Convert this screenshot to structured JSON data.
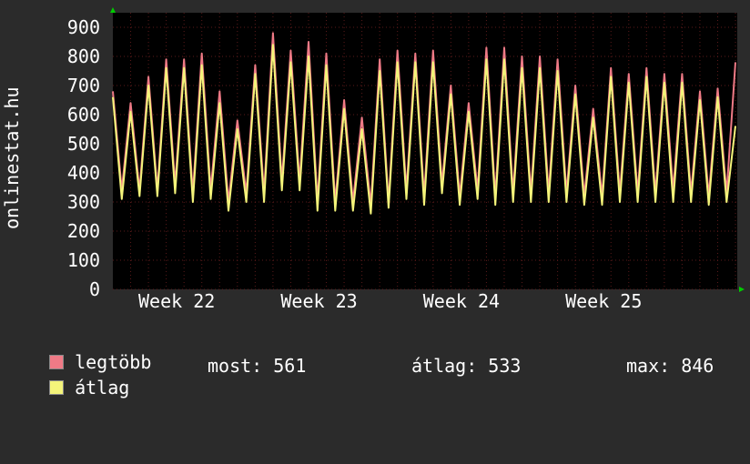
{
  "watermark": "onlinestat.hu",
  "legend": {
    "max_label": "legtöbb",
    "avg_label": "átlag",
    "colors": {
      "max": "#ef7a86",
      "avg": "#f4f47a"
    }
  },
  "stats": {
    "current": "most: 561",
    "average": "átlag: 533",
    "max": "max: 846"
  },
  "chart_data": {
    "type": "line",
    "xlabel": "",
    "ylabel": "",
    "ylim": [
      0,
      950
    ],
    "yticks": [
      0,
      100,
      200,
      300,
      400,
      500,
      600,
      700,
      800,
      900
    ],
    "grid": true,
    "background": "#000000",
    "xtick_labels": [
      "Week 22",
      "Week 23",
      "Week 24",
      "Week 25"
    ],
    "x_unit": "days",
    "xlim": [
      0,
      35.1
    ],
    "xtick_positions": [
      4.0,
      12.0,
      20.0,
      28.0
    ],
    "series": [
      {
        "name": "legtöbb",
        "color": "#ef7a86",
        "x": [
          0,
          0.5,
          1,
          1.5,
          2,
          2.5,
          3,
          3.5,
          4,
          4.5,
          5,
          5.5,
          6,
          6.5,
          7,
          7.5,
          8,
          8.5,
          9,
          9.5,
          10,
          10.5,
          11,
          11.5,
          12,
          12.5,
          13,
          13.5,
          14,
          14.5,
          15,
          15.5,
          16,
          16.5,
          17,
          17.5,
          18,
          18.5,
          19,
          19.5,
          20,
          20.5,
          21,
          21.5,
          22,
          22.5,
          23,
          23.5,
          24,
          24.5,
          25,
          25.5,
          26,
          26.5,
          27,
          27.5,
          28,
          28.5,
          29,
          29.5,
          30,
          30.5,
          31,
          31.5,
          32,
          32.5,
          33,
          33.5,
          34,
          34.5,
          35
        ],
        "values": [
          680,
          340,
          640,
          340,
          730,
          340,
          790,
          360,
          790,
          330,
          810,
          340,
          680,
          300,
          580,
          330,
          770,
          330,
          880,
          370,
          820,
          370,
          850,
          300,
          810,
          300,
          650,
          300,
          590,
          290,
          790,
          300,
          820,
          340,
          810,
          320,
          820,
          360,
          700,
          320,
          640,
          340,
          830,
          320,
          830,
          330,
          800,
          330,
          800,
          330,
          790,
          330,
          700,
          320,
          620,
          320,
          760,
          330,
          740,
          330,
          760,
          330,
          740,
          340,
          740,
          330,
          680,
          320,
          690,
          330,
          780
        ]
      },
      {
        "name": "átlag",
        "color": "#f4f47a",
        "x": [
          0,
          0.5,
          1,
          1.5,
          2,
          2.5,
          3,
          3.5,
          4,
          4.5,
          5,
          5.5,
          6,
          6.5,
          7,
          7.5,
          8,
          8.5,
          9,
          9.5,
          10,
          10.5,
          11,
          11.5,
          12,
          12.5,
          13,
          13.5,
          14,
          14.5,
          15,
          15.5,
          16,
          16.5,
          17,
          17.5,
          18,
          18.5,
          19,
          19.5,
          20,
          20.5,
          21,
          21.5,
          22,
          22.5,
          23,
          23.5,
          24,
          24.5,
          25,
          25.5,
          26,
          26.5,
          27,
          27.5,
          28,
          28.5,
          29,
          29.5,
          30,
          30.5,
          31,
          31.5,
          32,
          32.5,
          33,
          33.5,
          34,
          34.5,
          35
        ],
        "values": [
          660,
          310,
          610,
          320,
          700,
          320,
          760,
          330,
          760,
          300,
          770,
          310,
          640,
          270,
          550,
          300,
          740,
          300,
          840,
          340,
          780,
          340,
          800,
          270,
          770,
          270,
          620,
          270,
          550,
          260,
          750,
          280,
          780,
          310,
          780,
          290,
          780,
          330,
          670,
          290,
          610,
          310,
          790,
          290,
          790,
          300,
          760,
          300,
          760,
          300,
          750,
          300,
          670,
          290,
          590,
          290,
          730,
          300,
          710,
          300,
          730,
          300,
          710,
          300,
          710,
          300,
          650,
          290,
          660,
          300,
          561
        ]
      }
    ]
  }
}
